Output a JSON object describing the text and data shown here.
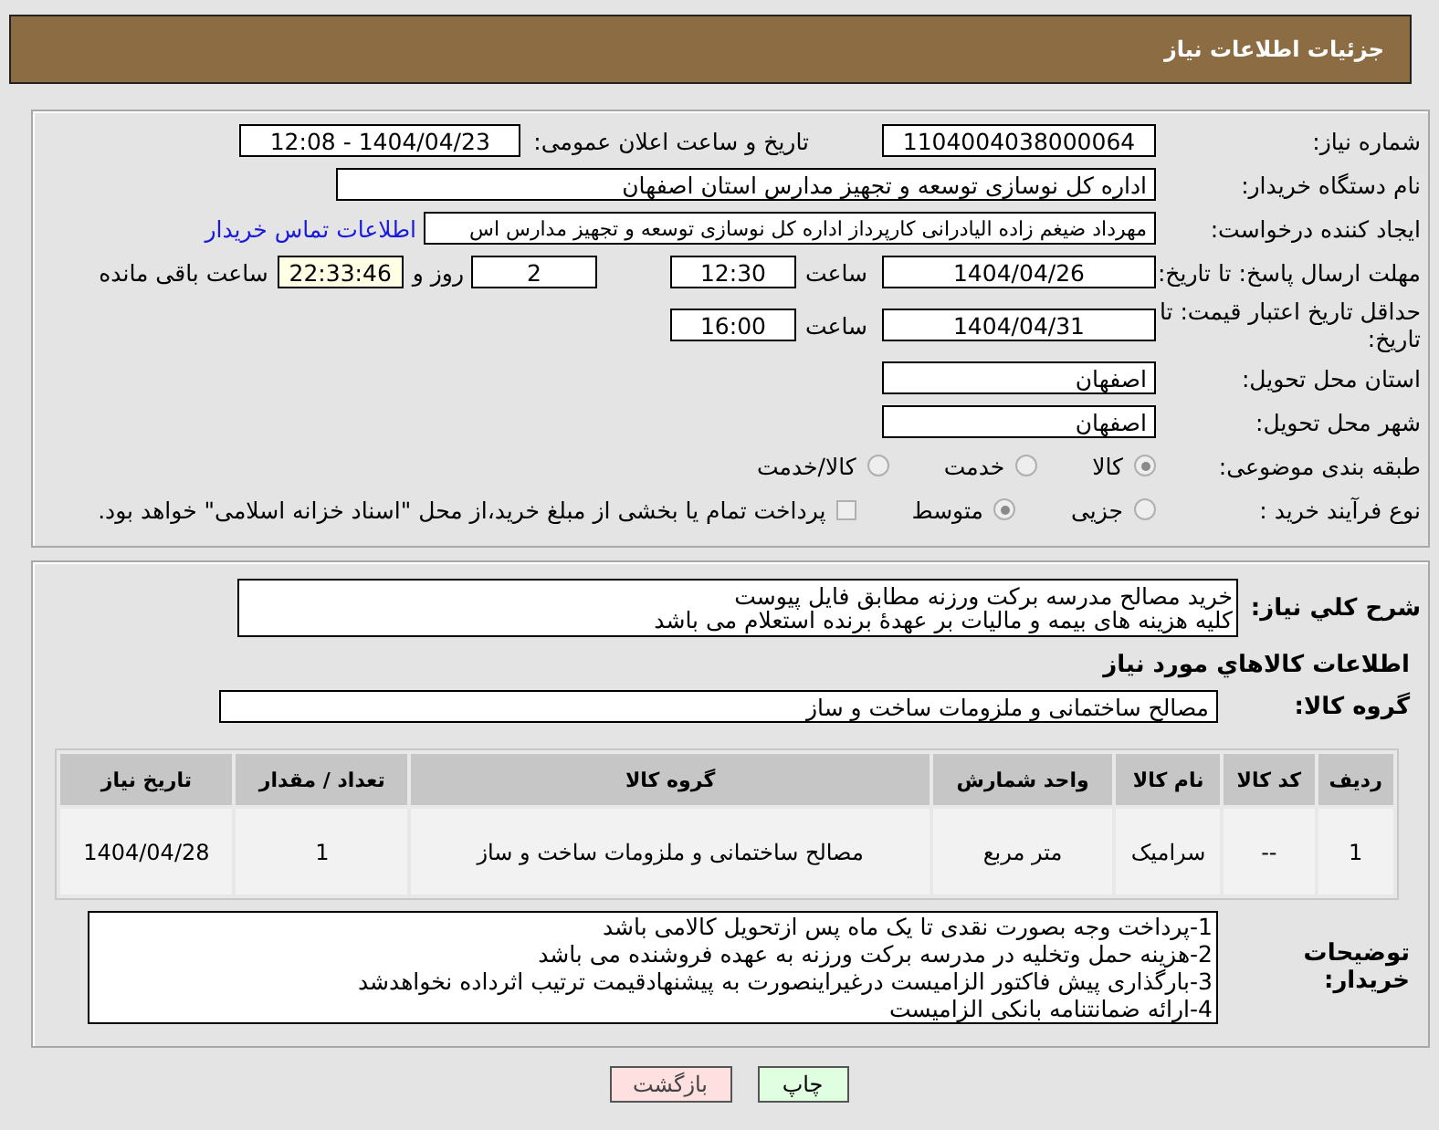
{
  "header": {
    "title": "جزئیات اطلاعات نیاز"
  },
  "need_number": {
    "label": "شماره نیاز:",
    "value": "1104004038000064"
  },
  "announce": {
    "label": "تاریخ و ساعت اعلان عمومی:",
    "value": "1404/04/23 - 12:08"
  },
  "buyer": {
    "label": "نام دستگاه خریدار:",
    "value": "اداره کل نوسازی  توسعه و تجهیز مدارس استان اصفهان"
  },
  "requester": {
    "label": "ایجاد کننده درخواست:",
    "value": "مهرداد ضیغم زاده الیادرانی کارپرداز اداره کل نوسازی  توسعه و تجهیز مدارس اس",
    "link": "اطلاعات تماس خریدار"
  },
  "reply_deadline": {
    "label": "مهلت ارسال پاسخ: تا تاریخ:",
    "date": "1404/04/26",
    "time_label": "ساعت",
    "time": "12:30",
    "days": "2",
    "days_label": "روز و",
    "remaining": "22:33:46",
    "remaining_label": "ساعت باقی مانده"
  },
  "price_validity": {
    "label": "حداقل تاریخ اعتبار قیمت: تا تاریخ:",
    "date": "1404/04/31",
    "time_label": "ساعت",
    "time": "16:00"
  },
  "province": {
    "label": "استان محل تحویل:",
    "value": "اصفهان"
  },
  "city": {
    "label": "شهر محل تحویل:",
    "value": "اصفهان"
  },
  "category": {
    "label": "طبقه بندی موضوعی:",
    "options": [
      {
        "label": "کالا",
        "selected": true
      },
      {
        "label": "خدمت",
        "selected": false
      },
      {
        "label": "کالا/خدمت",
        "selected": false
      }
    ]
  },
  "process": {
    "label": "نوع فرآیند خرید :",
    "options": [
      {
        "label": "جزیی",
        "selected": false
      },
      {
        "label": "متوسط",
        "selected": true
      }
    ],
    "treasury": {
      "checked": false,
      "text": "پرداخت تمام یا بخشی از مبلغ خرید،از محل \"اسناد خزانه اسلامی\" خواهد بود."
    }
  },
  "description": {
    "label": "شرح کلي نیاز:",
    "text": "خرید مصالح مدرسه برکت ورزنه مطابق فایل پیوست\nکلیه هزینه های بیمه و مالیات بر عهدهٔ برنده استعلام می باشد"
  },
  "goods_title": "اطلاعات کالاهاي مورد نياز",
  "group": {
    "label": "گروه کالا:",
    "value": "مصالح ساختمانی و ملزومات ساخت و ساز"
  },
  "table": {
    "columns": [
      "ردیف",
      "کد کالا",
      "نام کالا",
      "واحد شمارش",
      "گروه کالا",
      "تعداد / مقدار",
      "تاریخ نیاز"
    ],
    "rows": [
      [
        "1",
        "--",
        "سرامیک",
        "متر مربع",
        "مصالح ساختمانی و ملزومات ساخت و ساز",
        "1",
        "1404/04/28"
      ]
    ]
  },
  "buyer_notes": {
    "label": "توضیحات خریدار:",
    "text": "1-پرداخت وجه بصورت نقدی تا یک ماه پس ازتحویل کالامی باشد\n2-هزینه حمل وتخلیه در مدرسه برکت ورزنه به عهده فروشنده می باشد\n3-بارگذاری پیش فاکتور الزامیست درغیراینصورت به پیشنهادقیمت ترتیب اثرداده نخواهدشد\n4-ارائه ضمانتنامه بانکی الزامیست"
  },
  "buttons": [
    {
      "label": "چاپ",
      "kind": "print"
    },
    {
      "label": "بازگشت",
      "kind": "back"
    }
  ]
}
